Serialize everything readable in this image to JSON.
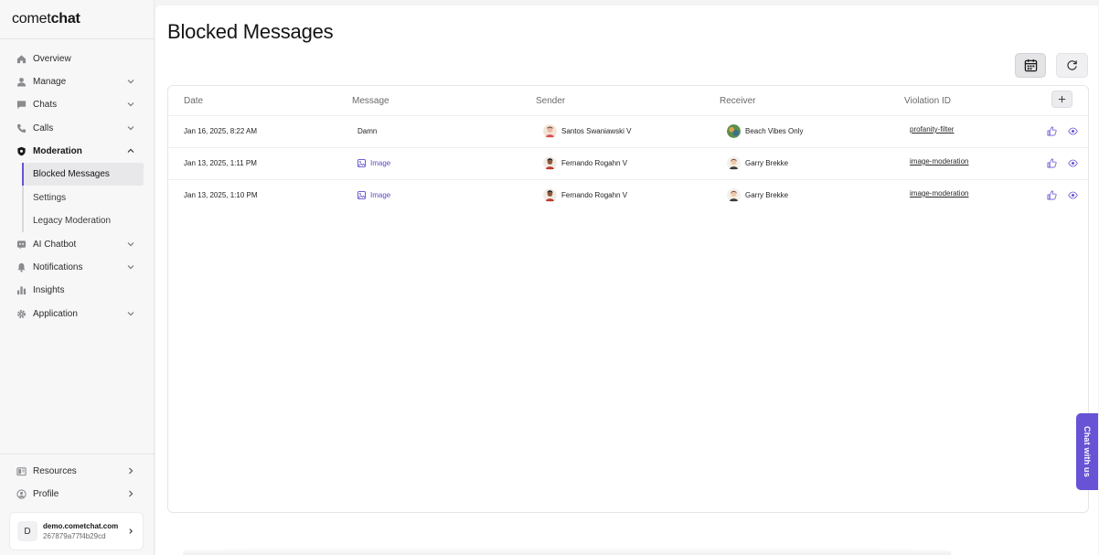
{
  "app": {
    "brand_light": "comet",
    "brand_bold": "chat"
  },
  "sidebar": {
    "items": [
      {
        "label": "Overview",
        "icon": "home-icon"
      },
      {
        "label": "Manage",
        "icon": "user-icon"
      },
      {
        "label": "Chats",
        "icon": "chat-icon"
      },
      {
        "label": "Calls",
        "icon": "phone-icon"
      },
      {
        "label": "Moderation",
        "icon": "shield-icon"
      },
      {
        "label": "AI Chatbot",
        "icon": "bot-icon"
      },
      {
        "label": "Notifications",
        "icon": "bell-icon"
      },
      {
        "label": "Insights",
        "icon": "bar-chart-icon"
      },
      {
        "label": "Application",
        "icon": "gear-icon"
      }
    ],
    "moderation_sub": [
      {
        "label": "Blocked Messages"
      },
      {
        "label": "Settings"
      },
      {
        "label": "Legacy Moderation"
      }
    ],
    "bottom": [
      {
        "label": "Resources",
        "icon": "book-icon"
      },
      {
        "label": "Profile",
        "icon": "profile-icon"
      }
    ],
    "account": {
      "initial": "D",
      "domain": "demo.cometchat.com",
      "id": "267879a77f4b29cd"
    }
  },
  "main": {
    "title": "Blocked Messages",
    "columns": [
      "Date",
      "Message",
      "Sender",
      "Receiver",
      "Violation ID"
    ],
    "rows": [
      {
        "date": "Jan 16, 2025, 8:22 AM",
        "message": "Damn",
        "message_type": "text",
        "sender": "Santos Swaniawski V",
        "receiver": "Beach Vibes Only",
        "violation": "profanity-filter"
      },
      {
        "date": "Jan 13, 2025, 1:11 PM",
        "message": "Image",
        "message_type": "image",
        "sender": "Fernando Rogahn V",
        "receiver": "Garry Brekke",
        "violation": "image-moderation"
      },
      {
        "date": "Jan 13, 2025, 1:10 PM",
        "message": "Image",
        "message_type": "image",
        "sender": "Fernando Rogahn V",
        "receiver": "Garry Brekke",
        "violation": "image-moderation"
      }
    ]
  },
  "chat_widget": {
    "label": "Chat with us"
  },
  "colors": {
    "accent": "#6852d6",
    "link": "#5b4ccc"
  }
}
